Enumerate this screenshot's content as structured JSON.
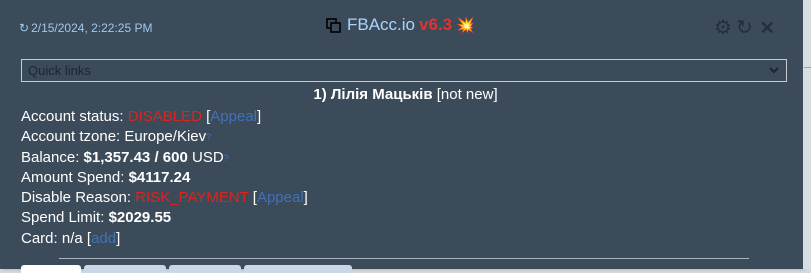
{
  "header": {
    "timestamp_icon": "↻",
    "timestamp": "2/15/2024, 2:22:25 PM",
    "title": "FBAcc.io",
    "version": "v6.3",
    "title_icon": "copy-icon",
    "version_emoji": "💥",
    "controls": [
      {
        "name": "settings-icon",
        "glyph": "⚙"
      },
      {
        "name": "refresh-icon",
        "glyph": "↻"
      },
      {
        "name": "close-icon",
        "glyph": "✕"
      }
    ]
  },
  "quick_links": {
    "selected": "Quick links"
  },
  "account": {
    "index": "1)",
    "name": "Лілія Мацьків",
    "tag": "[not new]"
  },
  "info": {
    "status_label": "Account status:",
    "status_value": "DISABLED",
    "status_action": "Appeal",
    "tzone_label": "Account tzone:",
    "tzone_value": "Europe/Kiev",
    "tzone_sup": "?",
    "balance_label": "Balance:",
    "balance_value": "$1,357.43 / 600",
    "balance_currency": "USD",
    "balance_sup": "?",
    "spend_label": "Amount Spend:",
    "spend_value": "$4117.24",
    "reason_label": "Disable Reason:",
    "reason_value": "RISK_PAYMENT",
    "reason_action": "Appeal",
    "limit_label": "Spend Limit:",
    "limit_value": "$2029.55",
    "card_label": "Card:",
    "card_value": "n/a",
    "card_action": "add"
  },
  "colors": {
    "panel_bg": "#3b4b5a",
    "accent_blue": "#a8d4ff",
    "danger_red": "#d9251f",
    "link_blue": "#3f72b8"
  }
}
